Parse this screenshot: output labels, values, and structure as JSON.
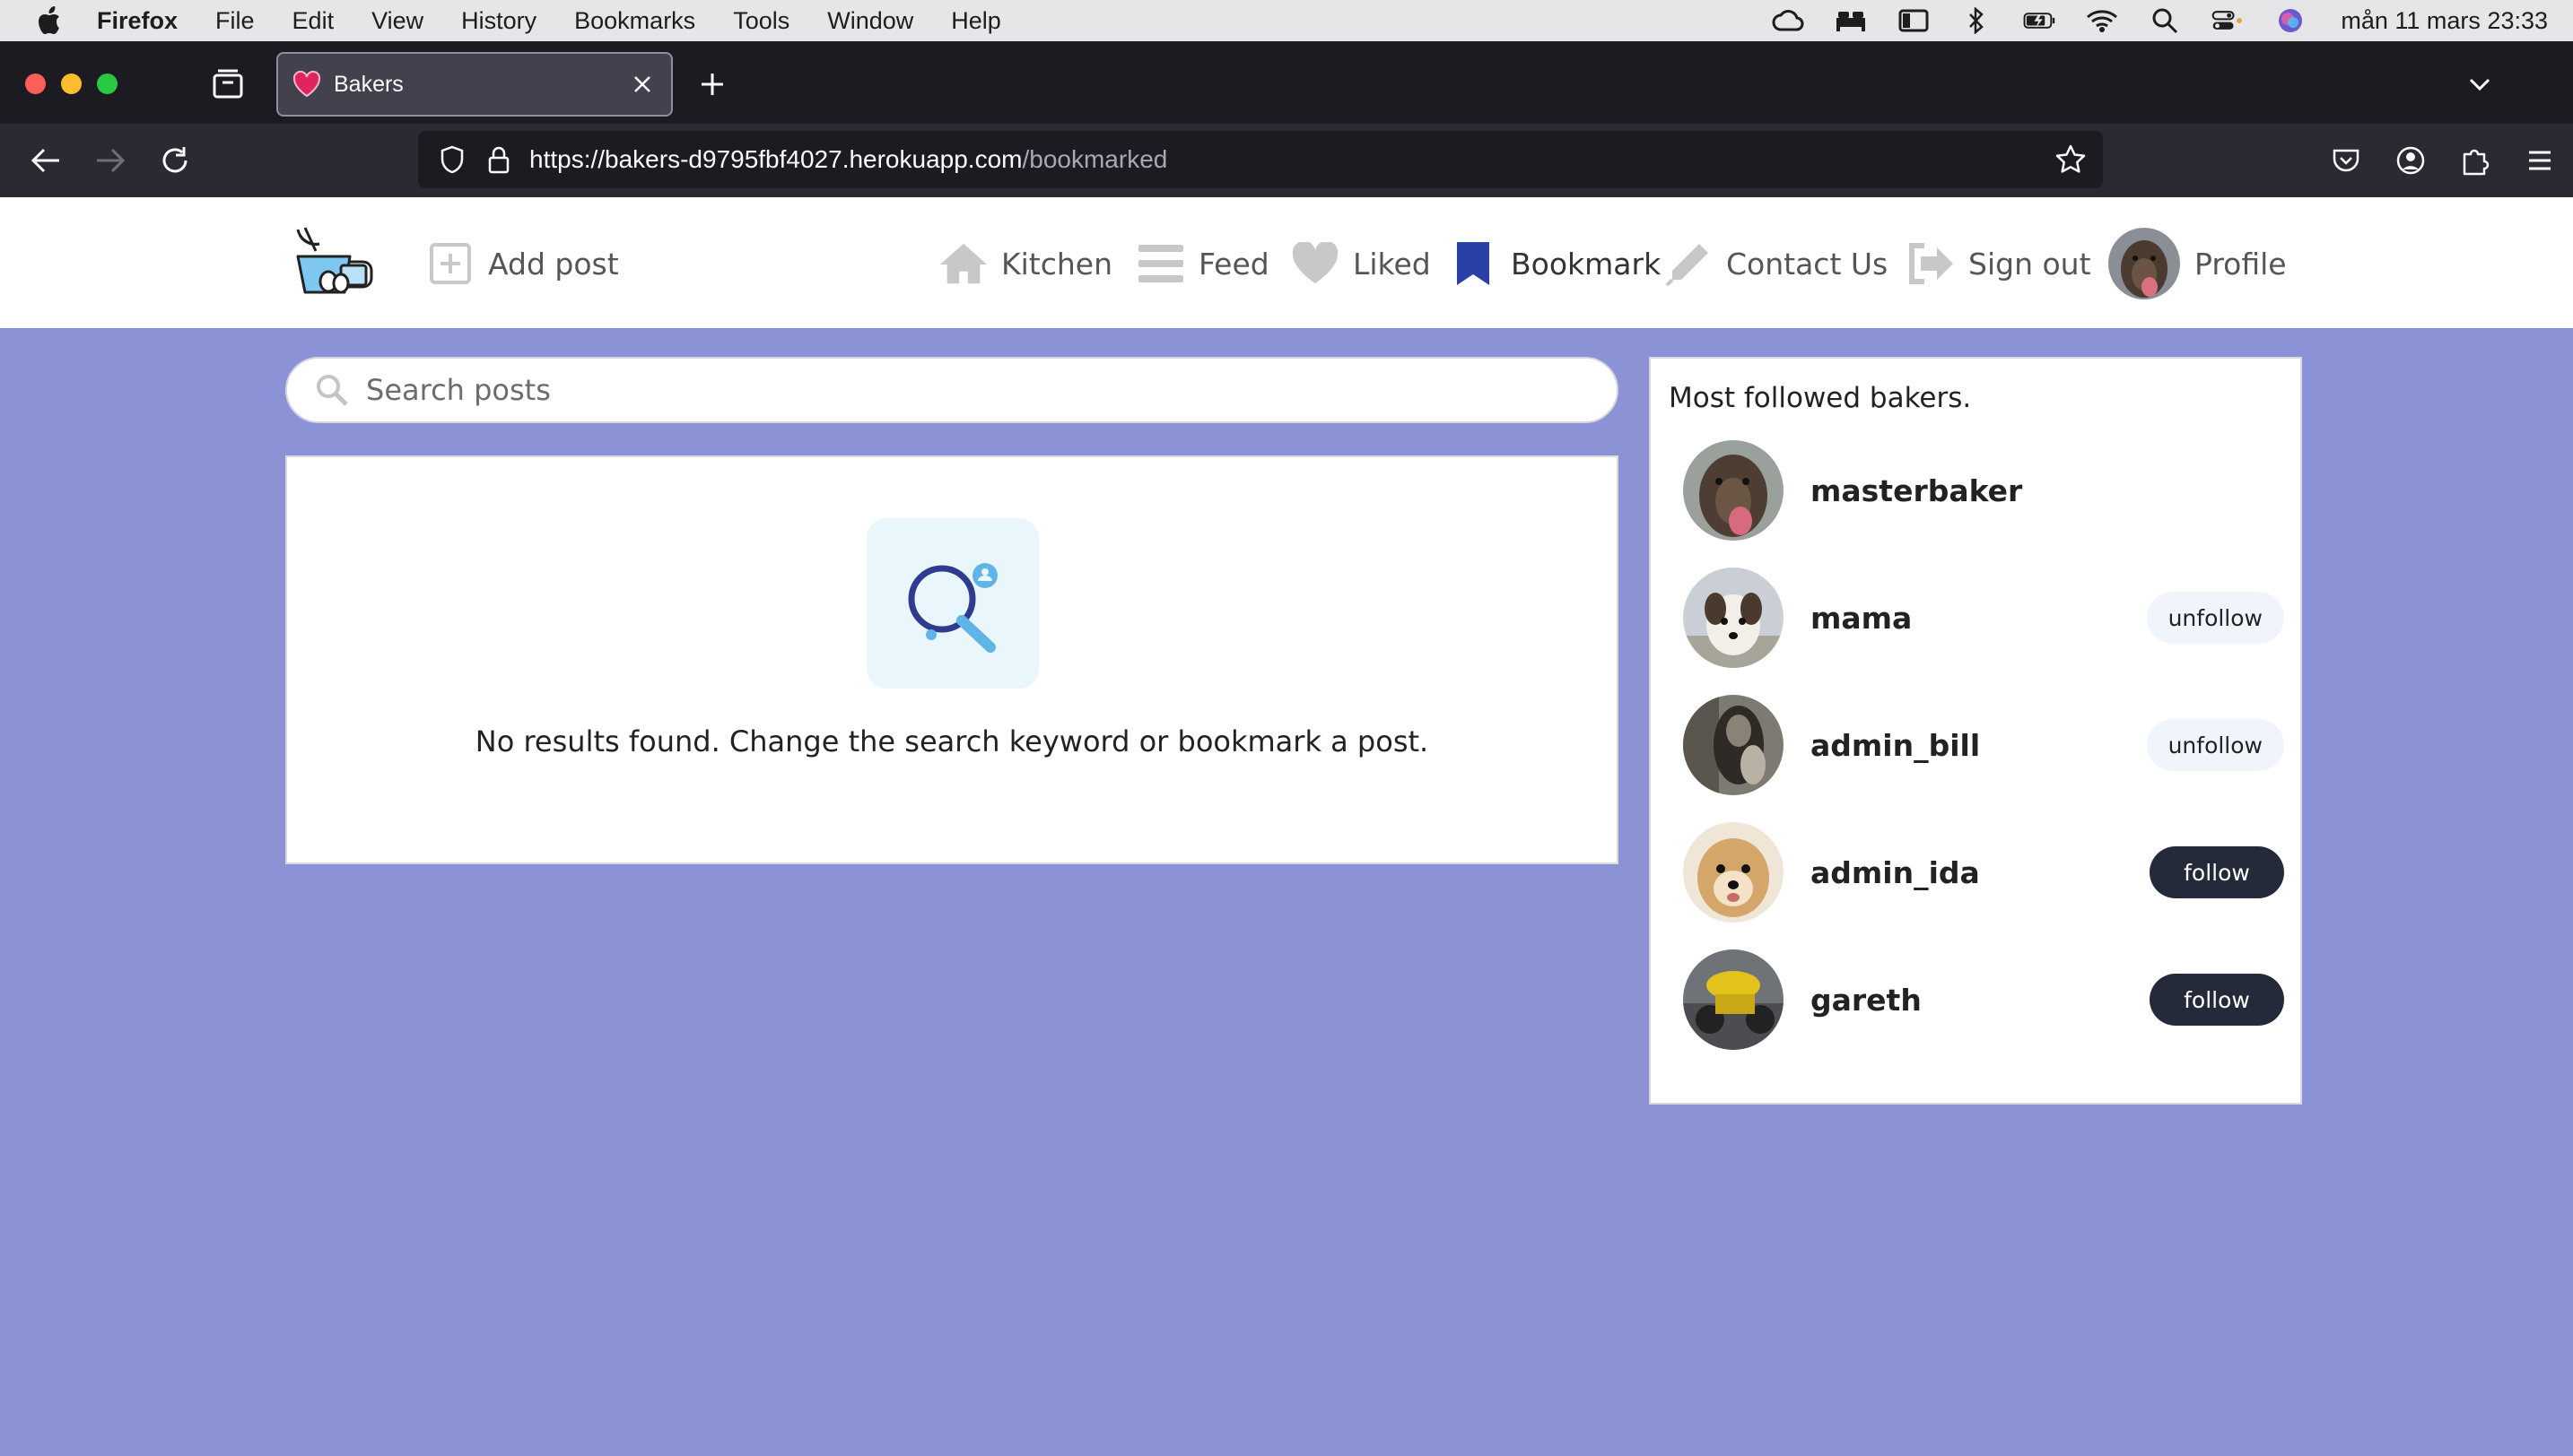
{
  "menubar": {
    "app": "Firefox",
    "items": [
      "File",
      "Edit",
      "View",
      "History",
      "Bookmarks",
      "Tools",
      "Window",
      "Help"
    ],
    "clock": "mån 11 mars 23:33"
  },
  "browser": {
    "tab_title": "Bakers",
    "url_host": "https://bakers-d9795fbf4027.herokuapp.com",
    "url_path": "/bookmarked"
  },
  "site": {
    "nav": {
      "add_post": "Add post",
      "kitchen": "Kitchen",
      "feed": "Feed",
      "liked": "Liked",
      "bookmark": "Bookmark",
      "contact": "Contact Us",
      "signout": "Sign out",
      "profile": "Profile"
    },
    "search_placeholder": "Search posts",
    "empty_message": "No results found. Change the search keyword or bookmark a post.",
    "sidebar_title": "Most followed bakers.",
    "bakers": [
      {
        "name": "masterbaker",
        "action": ""
      },
      {
        "name": "mama",
        "action": "unfollow"
      },
      {
        "name": "admin_bill",
        "action": "unfollow"
      },
      {
        "name": "admin_ida",
        "action": "follow"
      },
      {
        "name": "gareth",
        "action": "follow"
      }
    ],
    "colors": {
      "page_bg": "#8b93d6",
      "active_nav": "#2a3fa8",
      "follow_btn": "#242a3a"
    }
  }
}
